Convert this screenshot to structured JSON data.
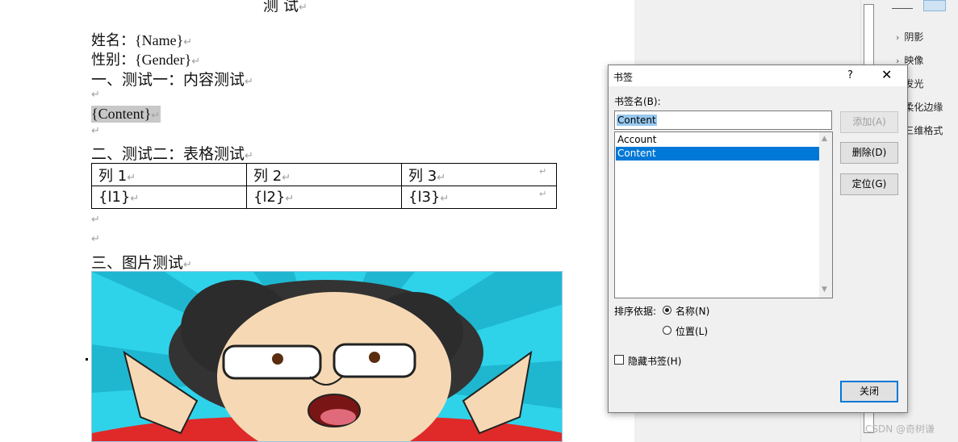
{
  "document": {
    "title": "测  试",
    "name_line": "姓名：{Name}",
    "gender_line": "性别：{Gender}",
    "heading1": "一、测试一：内容测试",
    "content_placeholder": "{Content}",
    "heading2": "二、测试二：表格测试",
    "table": {
      "headers": [
        "列 1",
        "列 2",
        "列 3"
      ],
      "row": [
        "{l1}",
        "{l2}",
        "{l3}"
      ]
    },
    "heading3": "三、图片测试",
    "para_mark": "↵"
  },
  "format_pane": {
    "items": [
      "阴影",
      "映像",
      "发光",
      "柔化边缘",
      "三维格式"
    ]
  },
  "dialog": {
    "title": "书签",
    "help": "?",
    "close_glyph": "✕",
    "name_label": "书签名(B):",
    "name_value": "Content",
    "bookmarks": [
      "Account",
      "Content"
    ],
    "selected_index": 1,
    "buttons": {
      "add": "添加(A)",
      "delete": "删除(D)",
      "goto": "定位(G)",
      "close": "关闭"
    },
    "sort_label": "排序依据:",
    "sort_options": [
      "名称(N)",
      "位置(L)"
    ],
    "sort_selected": "名称(N)",
    "hidden_label": "隐藏书签(H)",
    "hidden_checked": false,
    "colors": {
      "selection": "#0078d7",
      "name_highlight": "#99c9ef"
    }
  },
  "watermark": "CSDN @奇树谦"
}
